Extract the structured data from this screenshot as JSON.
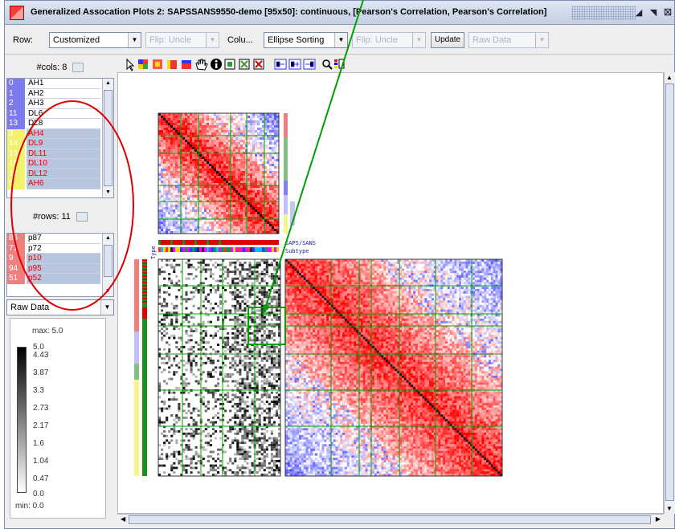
{
  "window": {
    "title": "Generalized Assocation Plots 2: SAPSSANS9550-demo [95x50]: continuous, [Pearson's Correlation, Pearson's Correlation]",
    "minimize_icon": "minimize-icon",
    "maximize_icon": "maximize-icon",
    "close_icon": "close-icon"
  },
  "toolbar": {
    "row_label": "Row:",
    "row_select": "Customized",
    "row_flip": "Flip: Uncle",
    "col_label": "Colu...",
    "col_select": "Ellipse Sorting",
    "col_flip": "Flip: Uncle",
    "update_label": "Update",
    "data_select": "Raw Data"
  },
  "cols_panel": {
    "header": "#cols: 8",
    "items": [
      {
        "idx": "0",
        "name": "AH1",
        "color": "#7b7bef",
        "sel": false
      },
      {
        "idx": "1",
        "name": "AH2",
        "color": "#7b7bef",
        "sel": false
      },
      {
        "idx": "2",
        "name": "AH3",
        "color": "#7b7bef",
        "sel": false
      },
      {
        "idx": "11",
        "name": "DL6",
        "color": "#7b7bef",
        "sel": false
      },
      {
        "idx": "13",
        "name": "DL8",
        "color": "#7b7bef",
        "sel": false
      },
      {
        "idx": "3",
        "name": "AH4",
        "color": "#f3f36b",
        "sel": true
      },
      {
        "idx": "14",
        "name": "DL9",
        "color": "#f3f36b",
        "sel": true
      },
      {
        "idx": "16",
        "name": "DL11",
        "color": "#f3f36b",
        "sel": true
      },
      {
        "idx": "15",
        "name": "DL10",
        "color": "#f3f36b",
        "sel": true
      },
      {
        "idx": "17",
        "name": "DL12",
        "color": "#f3f36b",
        "sel": true
      },
      {
        "idx": "5",
        "name": "AH6",
        "color": "#f3f36b",
        "sel": true
      }
    ]
  },
  "rows_panel": {
    "header": "#rows: 11",
    "items": [
      {
        "idx": "86",
        "name": "p87",
        "color": "#f08080",
        "sel": false
      },
      {
        "idx": "71",
        "name": "p72",
        "color": "#f08080",
        "sel": false
      },
      {
        "idx": "9",
        "name": "p10",
        "color": "#f08080",
        "sel": true
      },
      {
        "idx": "94",
        "name": "p95",
        "color": "#f08080",
        "sel": true
      },
      {
        "idx": "51",
        "name": "p52",
        "color": "#f08080",
        "sel": true
      }
    ]
  },
  "display_select": "Raw Data",
  "legend": {
    "max": "max: 5.0",
    "min": "min: 0.0",
    "ticks": [
      "5.0",
      "4.43",
      "3.87",
      "3.3",
      "2.73",
      "2.17",
      "1.6",
      "1.04",
      "0.47",
      "0.0"
    ]
  },
  "plot_labels": {
    "saps": "SAPS/SANS",
    "subtype": "Subtype",
    "type": "Type"
  },
  "colors": {
    "title_bg": "#c4cfe3",
    "panel_bg": "#eeeeee",
    "selection": "#b7c5de",
    "annotation_red": "#e00000",
    "annotation_green": "#00a000",
    "corr_pos": "#ff0000",
    "corr_neg": "#3333ff"
  }
}
